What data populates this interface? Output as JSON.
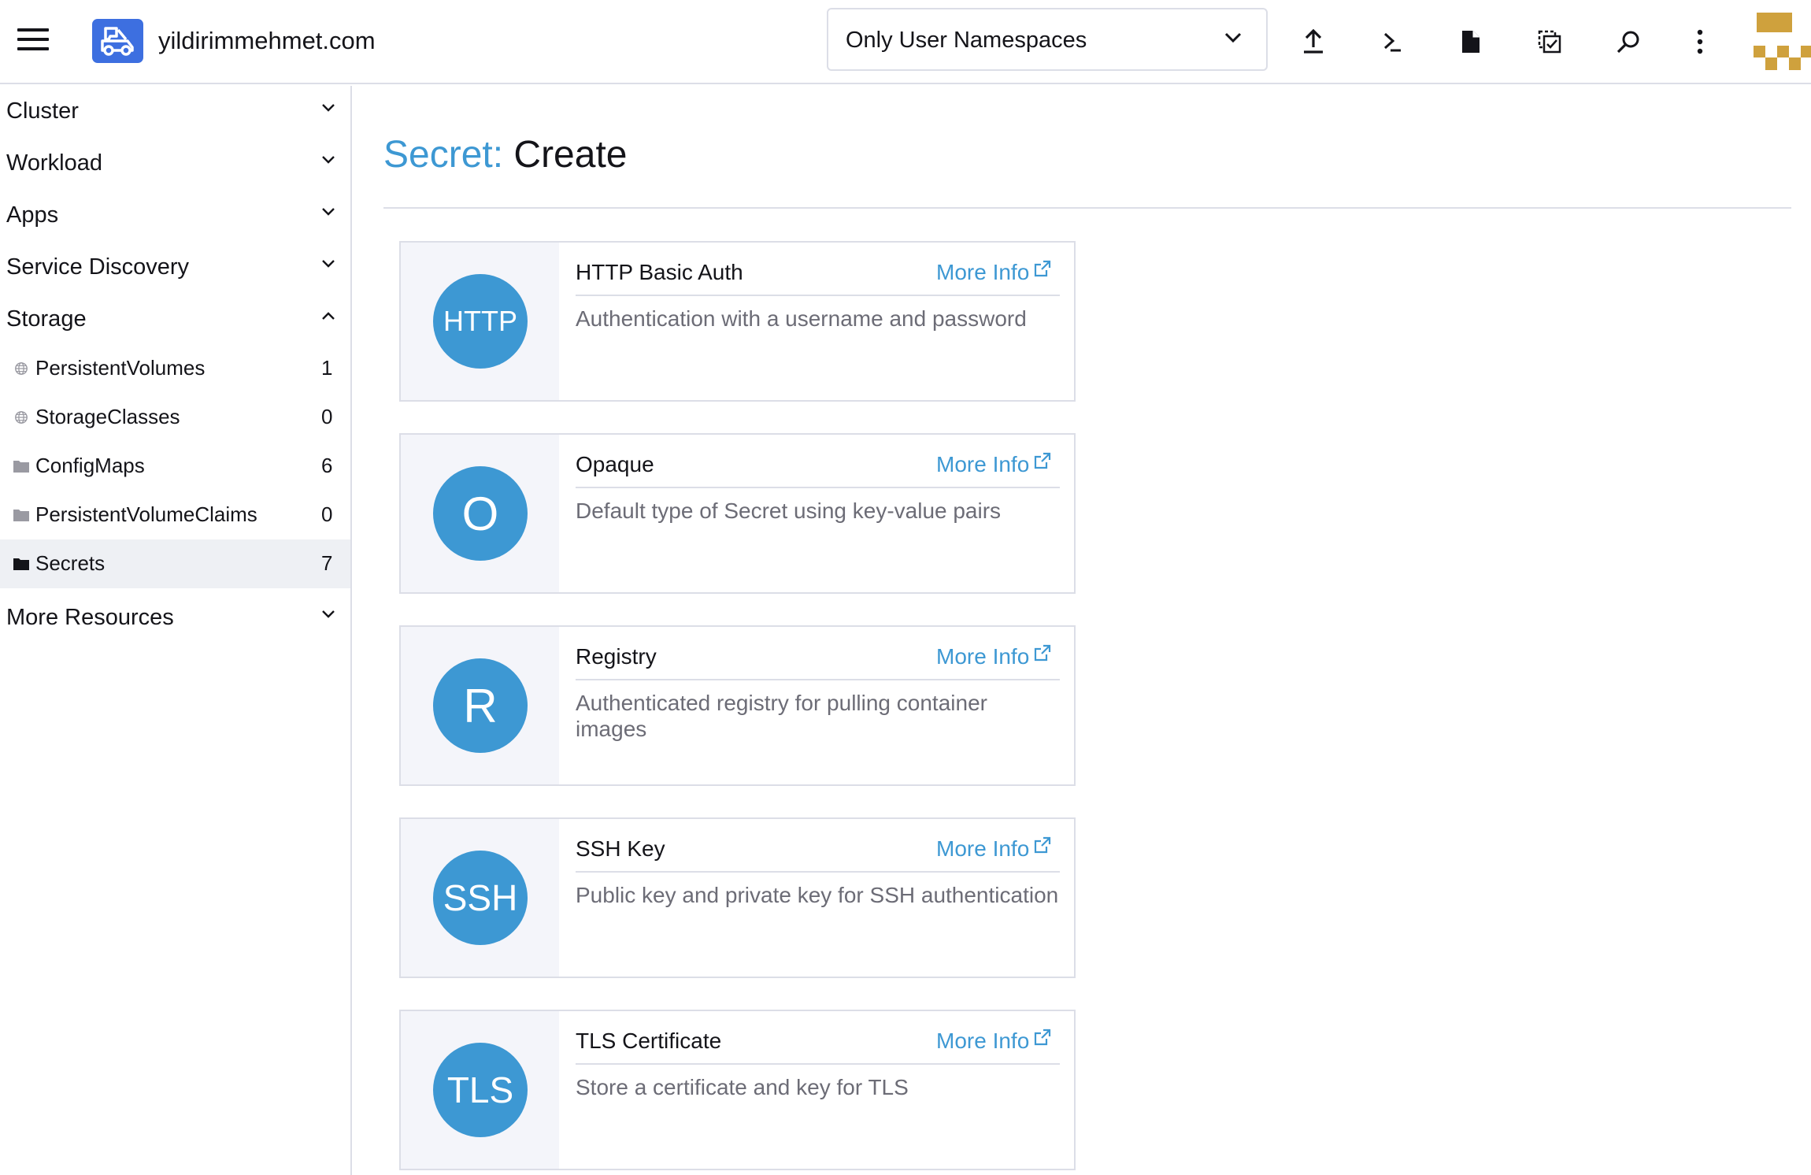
{
  "header": {
    "cluster_name": "yildirimmehmet.com",
    "namespace_filter": "Only User Namespaces"
  },
  "sidebar": {
    "groups": [
      {
        "label": "Cluster",
        "expanded": false
      },
      {
        "label": "Workload",
        "expanded": false
      },
      {
        "label": "Apps",
        "expanded": false
      },
      {
        "label": "Service Discovery",
        "expanded": false
      },
      {
        "label": "Storage",
        "expanded": true
      },
      {
        "label": "More Resources",
        "expanded": false
      }
    ],
    "storage_items": [
      {
        "label": "PersistentVolumes",
        "count": "1",
        "icon": "globe-icon"
      },
      {
        "label": "StorageClasses",
        "count": "0",
        "icon": "globe-icon"
      },
      {
        "label": "ConfigMaps",
        "count": "6",
        "icon": "folder-icon"
      },
      {
        "label": "PersistentVolumeClaims",
        "count": "0",
        "icon": "folder-icon"
      },
      {
        "label": "Secrets",
        "count": "7",
        "icon": "folder-icon",
        "active": true
      }
    ]
  },
  "page": {
    "resource": "Secret:",
    "action": "Create"
  },
  "secret_types": [
    {
      "initials": "HTTP",
      "name": "HTTP Basic Auth",
      "more_info": "More Info",
      "description": "Authentication with a username and password"
    },
    {
      "initials": "O",
      "name": "Opaque",
      "more_info": "More Info",
      "description": "Default type of Secret using key-value pairs"
    },
    {
      "initials": "R",
      "name": "Registry",
      "more_info": "More Info",
      "description": "Authenticated registry for pulling container images"
    },
    {
      "initials": "SSH",
      "name": "SSH Key",
      "more_info": "More Info",
      "description": "Public key and private key for SSH authentication"
    },
    {
      "initials": "TLS",
      "name": "TLS Certificate",
      "more_info": "More Info",
      "description": "Store a certificate and key for TLS"
    }
  ],
  "colors": {
    "accent": "#3d98d3",
    "logo": "#3d6fe0",
    "active_row": "#eef0f4",
    "avatar": "#cfa13d"
  }
}
